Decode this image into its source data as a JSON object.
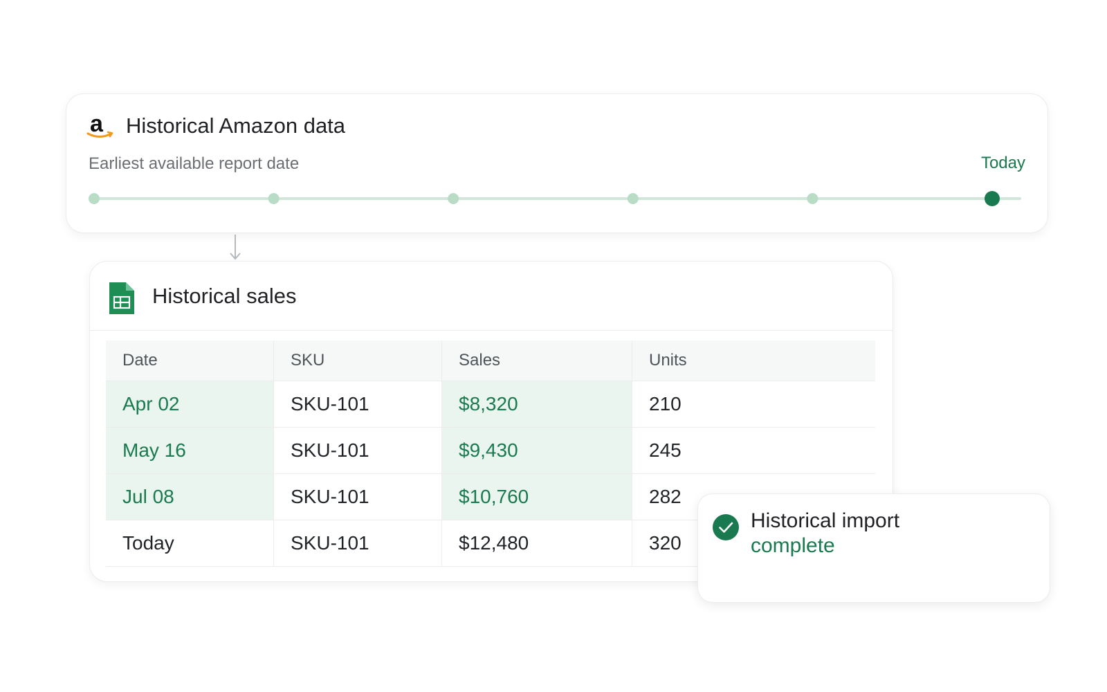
{
  "amazon_card": {
    "title": "Historical Amazon data",
    "earliest_label": "Earliest available report date",
    "today_label": "Today",
    "timeline": {
      "points": 6,
      "active_index": 5
    }
  },
  "sales_card": {
    "title": "Historical sales",
    "columns": [
      "Date",
      "SKU",
      "Sales",
      "Units"
    ],
    "rows": [
      {
        "date": "Apr 02",
        "sku": "SKU-101",
        "sales": "$8,320",
        "units": "210"
      },
      {
        "date": "May 16",
        "sku": "SKU-101",
        "sales": "$9,430",
        "units": "245"
      },
      {
        "date": "Jul 08",
        "sku": "SKU-101",
        "sales": "$10,760",
        "units": "282"
      },
      {
        "date": "Today",
        "sku": "SKU-101",
        "sales": "$12,480",
        "units": "320"
      }
    ]
  },
  "toast": {
    "line1": "Historical import",
    "line2": "complete"
  },
  "colors": {
    "accent": "#1a7a4f",
    "highlight": "#e9f5ee",
    "timeline_inactive": "#b9dcc7",
    "amazon_orange": "#f39a1e"
  },
  "icons": [
    "amazon-logo-icon",
    "arrow-down-icon",
    "google-sheets-icon",
    "check-circle-icon"
  ]
}
